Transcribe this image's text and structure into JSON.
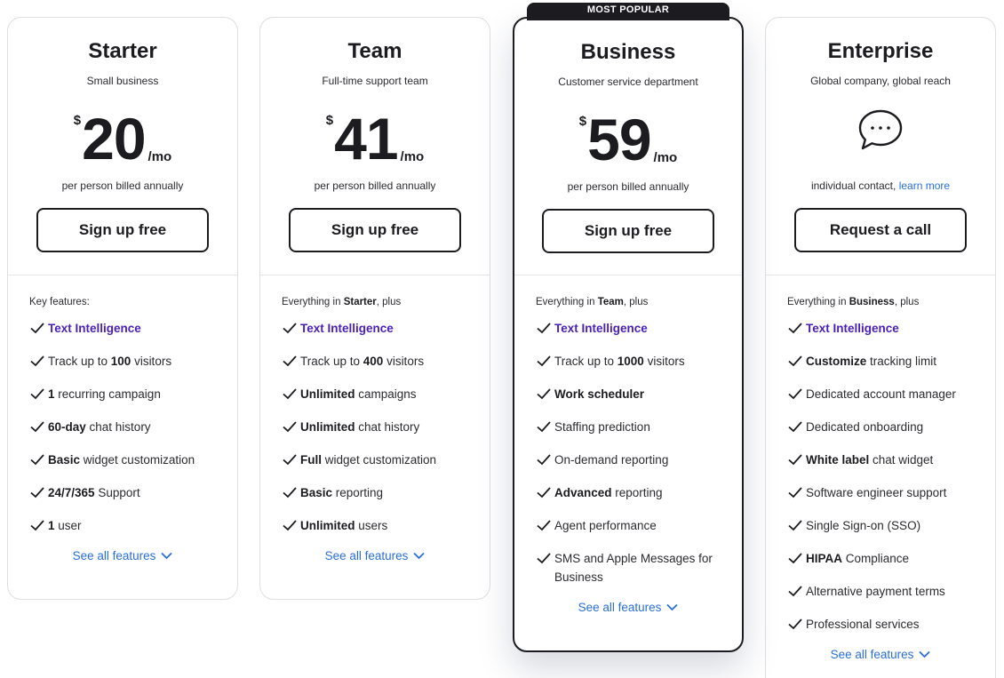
{
  "plans": [
    {
      "name": "Starter",
      "subtitle": "Small business",
      "currency": "$",
      "price": "20",
      "period": "/mo",
      "billing": "per person billed annually",
      "cta": "Sign up free",
      "intro": "Key features:",
      "features": [
        {
          "pre": "",
          "bold": "",
          "post": "Text Intelligence",
          "highlight": true
        },
        {
          "pre": "Track up to ",
          "bold": "100",
          "post": " visitors"
        },
        {
          "pre": "",
          "bold": "1",
          "post": " recurring campaign"
        },
        {
          "pre": "",
          "bold": "60-day",
          "post": " chat history"
        },
        {
          "pre": "",
          "bold": "Basic",
          "post": " widget customization"
        },
        {
          "pre": "",
          "bold": "24/7/365",
          "post": " Support"
        },
        {
          "pre": "",
          "bold": "1",
          "post": " user"
        }
      ],
      "see_all": "See all features"
    },
    {
      "name": "Team",
      "subtitle": "Full-time support team",
      "currency": "$",
      "price": "41",
      "period": "/mo",
      "billing": "per person billed annually",
      "cta": "Sign up free",
      "intro_pre": "Everything in ",
      "intro_bold": "Starter",
      "intro_post": ", plus",
      "features": [
        {
          "pre": "",
          "bold": "",
          "post": "Text Intelligence",
          "highlight": true
        },
        {
          "pre": "Track up to ",
          "bold": "400",
          "post": " visitors"
        },
        {
          "pre": "",
          "bold": "Unlimited",
          "post": " campaigns"
        },
        {
          "pre": "",
          "bold": "Unlimited",
          "post": " chat history"
        },
        {
          "pre": "",
          "bold": "Full",
          "post": " widget customization"
        },
        {
          "pre": "",
          "bold": "Basic",
          "post": " reporting"
        },
        {
          "pre": "",
          "bold": "Unlimited",
          "post": " users"
        }
      ],
      "see_all": "See all features"
    },
    {
      "badge": "MOST POPULAR",
      "name": "Business",
      "subtitle": "Customer service department",
      "currency": "$",
      "price": "59",
      "period": "/mo",
      "billing": "per person billed annually",
      "cta": "Sign up free",
      "intro_pre": "Everything in ",
      "intro_bold": "Team",
      "intro_post": ", plus",
      "features": [
        {
          "pre": "",
          "bold": "",
          "post": "Text Intelligence",
          "highlight": true
        },
        {
          "pre": "Track up to ",
          "bold": "1000",
          "post": " visitors"
        },
        {
          "pre": "",
          "bold": "Work scheduler",
          "post": ""
        },
        {
          "pre": "Staffing prediction",
          "bold": "",
          "post": ""
        },
        {
          "pre": "On-demand reporting",
          "bold": "",
          "post": ""
        },
        {
          "pre": "",
          "bold": "Advanced",
          "post": " reporting"
        },
        {
          "pre": "Agent performance",
          "bold": "",
          "post": ""
        },
        {
          "pre": "SMS and Apple Messages for Business",
          "bold": "",
          "post": ""
        }
      ],
      "see_all": "See all features"
    },
    {
      "name": "Enterprise",
      "subtitle": "Global company, global reach",
      "billing": "individual contact, ",
      "billing_link": "learn more",
      "cta": "Request a call",
      "intro_pre": "Everything in ",
      "intro_bold": "Business",
      "intro_post": ", plus",
      "features": [
        {
          "pre": "",
          "bold": "",
          "post": "Text Intelligence",
          "highlight": true
        },
        {
          "pre": "",
          "bold": "Customize",
          "post": " tracking limit"
        },
        {
          "pre": "Dedicated account manager",
          "bold": "",
          "post": ""
        },
        {
          "pre": "Dedicated onboarding",
          "bold": "",
          "post": ""
        },
        {
          "pre": "",
          "bold": "White label",
          "post": " chat widget"
        },
        {
          "pre": "Software engineer support",
          "bold": "",
          "post": ""
        },
        {
          "pre": "Single Sign-on (SSO)",
          "bold": "",
          "post": ""
        },
        {
          "pre": "",
          "bold": "HIPAA",
          "post": " Compliance"
        },
        {
          "pre": "Alternative payment terms",
          "bold": "",
          "post": ""
        },
        {
          "pre": "Professional services",
          "bold": "",
          "post": ""
        }
      ],
      "see_all": "See all features"
    }
  ],
  "colors": {
    "text": "#1b1b20",
    "link": "#2a6fd6",
    "highlight": "#4a1fb8",
    "border": "#dedee3"
  },
  "icons": {
    "check": "check-icon",
    "chevron": "chevron-down-icon",
    "chat": "chat-bubble-icon"
  }
}
